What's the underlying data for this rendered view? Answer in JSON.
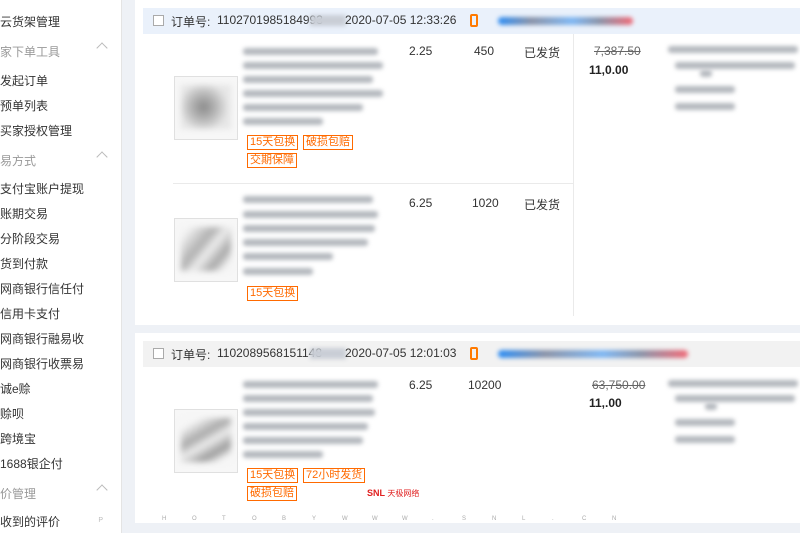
{
  "sidebar": {
    "items": [
      {
        "label": "云货架管理",
        "type": "item"
      },
      {
        "label": "家下单工具",
        "type": "group"
      },
      {
        "label": "发起订单",
        "type": "item"
      },
      {
        "label": "预单列表",
        "type": "item"
      },
      {
        "label": "买家授权管理",
        "type": "item"
      },
      {
        "label": "易方式",
        "type": "group"
      },
      {
        "label": "支付宝账户提现",
        "type": "item"
      },
      {
        "label": "账期交易",
        "type": "item"
      },
      {
        "label": "分阶段交易",
        "type": "item"
      },
      {
        "label": "货到付款",
        "type": "item"
      },
      {
        "label": "网商银行信任付",
        "type": "item"
      },
      {
        "label": "信用卡支付",
        "type": "item"
      },
      {
        "label": "网商银行融易收",
        "type": "item"
      },
      {
        "label": "网商银行收票易",
        "type": "item"
      },
      {
        "label": "诚e赊",
        "type": "item"
      },
      {
        "label": "赊呗",
        "type": "item"
      },
      {
        "label": "跨境宝",
        "type": "item"
      },
      {
        "label": "1688银企付",
        "type": "item"
      },
      {
        "label": "价管理",
        "type": "group"
      },
      {
        "label": "收到的评价",
        "type": "item"
      }
    ],
    "footer_p": "P"
  },
  "orders": [
    {
      "label": "订单号:",
      "number": "1102701985184993",
      "time": "2020-07-05 12:33:26",
      "items": [
        {
          "price": "2.25",
          "qty": "450",
          "status": "已发货",
          "tags": [
            "15天包换",
            "破损包赔",
            "交期保障"
          ]
        },
        {
          "price": "6.25",
          "qty": "1020",
          "status": "已发货",
          "tags": [
            "15天包换"
          ]
        }
      ],
      "original_total": "7,387.50",
      "total": "11,0​.00"
    },
    {
      "label": "订单号:",
      "number": "1102089568151148",
      "time": "2020-07-05 12:01:03",
      "items": [
        {
          "price": "6.25",
          "qty": "10200",
          "status": "",
          "tags": [
            "15天包换",
            "72小时发货",
            "破损包赔"
          ]
        }
      ],
      "original_total": "63,750.00",
      "total": "11,​.00"
    }
  ],
  "watermark": {
    "brand": "SNL",
    "sub": "天极网络",
    "letters": [
      "H",
      "O",
      "T",
      "O",
      "B",
      "Y",
      "W",
      "W",
      "W",
      ".",
      "S",
      "N",
      "L",
      ".",
      "C",
      "N"
    ]
  },
  "colors": {
    "accent": "#ff6a00",
    "head_blue": "#eaf1fb"
  }
}
